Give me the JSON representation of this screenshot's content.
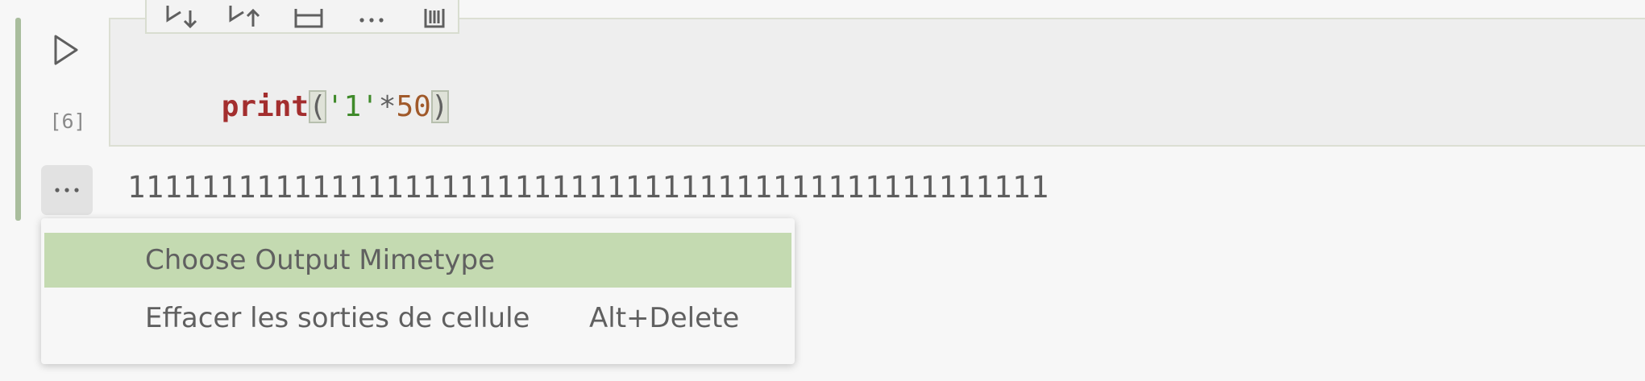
{
  "cell": {
    "execution_count": "[6]",
    "code_tokens": [
      {
        "text": "print",
        "kind": "kw"
      },
      {
        "text": "(",
        "kind": "paren"
      },
      {
        "text": "'1'",
        "kind": "str"
      },
      {
        "text": "*",
        "kind": "op"
      },
      {
        "text": "50",
        "kind": "num"
      },
      {
        "text": ")",
        "kind": "paren"
      }
    ],
    "output": "11111111111111111111111111111111111111111111111111"
  },
  "toolbar": {
    "icons": [
      "execute-above-icon",
      "execute-below-icon",
      "split-cell-icon",
      "more-actions-icon",
      "delete-cell-icon"
    ]
  },
  "output_more": {
    "icon": "ellipsis-icon",
    "label": "···"
  },
  "context_menu": {
    "items": [
      {
        "label": "Choose Output Mimetype",
        "shortcut": "",
        "selected": true
      },
      {
        "label": "Effacer les sorties de cellule",
        "shortcut": "Alt+Delete",
        "selected": false
      }
    ]
  },
  "colors": {
    "focus_bar": "#a9bd9d",
    "menu_highlight": "#c4dab1",
    "keyword": "#a32e2e",
    "string": "#3f8a2a",
    "number": "#a0592a"
  }
}
